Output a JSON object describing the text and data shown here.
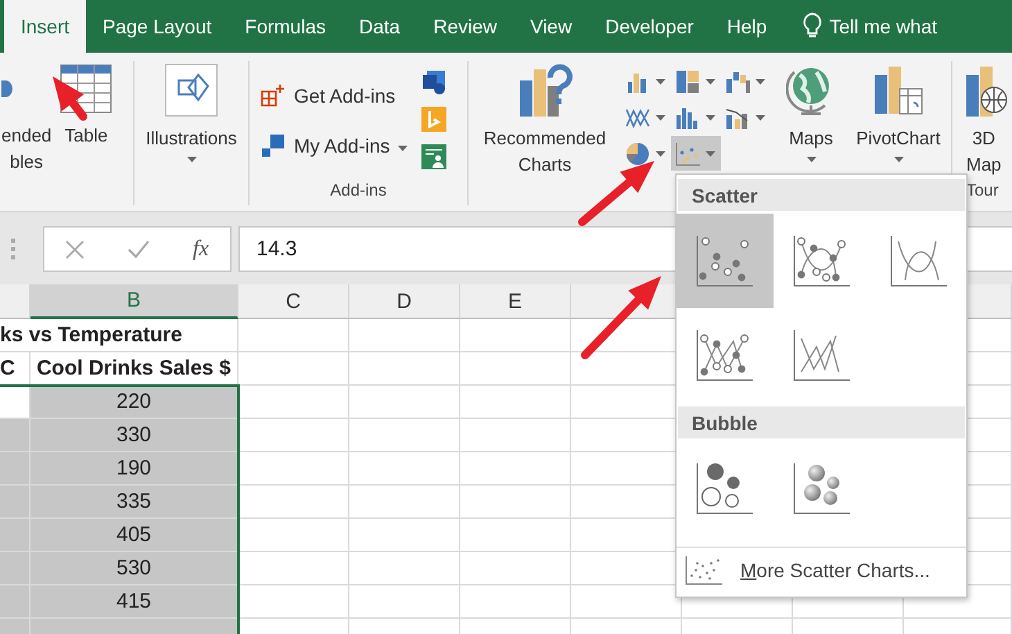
{
  "tabs": [
    {
      "label": "Insert",
      "selected": true
    },
    {
      "label": "Page Layout",
      "selected": false
    },
    {
      "label": "Formulas",
      "selected": false
    },
    {
      "label": "Data",
      "selected": false
    },
    {
      "label": "Review",
      "selected": false
    },
    {
      "label": "View",
      "selected": false
    },
    {
      "label": "Developer",
      "selected": false
    },
    {
      "label": "Help",
      "selected": false
    }
  ],
  "tell_me": "Tell me what",
  "ribbon": {
    "tables": {
      "recommended_lines": [
        "ended",
        "bles"
      ],
      "table_label": "Table"
    },
    "illustrations": {
      "label": "Illustrations"
    },
    "addins": {
      "get_label": "Get Add-ins",
      "my_label": "My Add-ins",
      "group_label": "Add-ins"
    },
    "charts": {
      "recommended_lines": [
        "Recommended",
        "Charts"
      ],
      "chart_buttons": [
        {
          "kind": "column",
          "selected": false
        },
        {
          "kind": "hierarchy",
          "selected": false
        },
        {
          "kind": "waterfall",
          "selected": false
        },
        {
          "kind": "line",
          "selected": false
        },
        {
          "kind": "statistic",
          "selected": false
        },
        {
          "kind": "combo",
          "selected": false
        },
        {
          "kind": "pie",
          "selected": false
        },
        {
          "kind": "scatter",
          "selected": true
        }
      ],
      "maps_label": "Maps",
      "pivotchart_label": "PivotChart"
    },
    "tours": {
      "label_lines": [
        "3D",
        "Map"
      ],
      "group_label": "Tour"
    }
  },
  "formula_bar": {
    "fx": "fx",
    "value": "14.3"
  },
  "columns": [
    {
      "selected": false
    },
    {
      "label": "B",
      "selected": true
    },
    {
      "label": "C",
      "selected": false
    },
    {
      "label": "D",
      "selected": false
    },
    {
      "label": "E",
      "selected": false
    },
    {
      "selected": false
    }
  ],
  "rows": [
    {
      "kind": "title",
      "text": "ks vs Temperature"
    },
    {
      "kind": "data",
      "cells": [
        {
          "text": "C",
          "selected": false
        },
        {
          "text": "Cool Drinks Sales $",
          "selected": false
        }
      ]
    },
    {
      "kind": "data",
      "cells": [
        {
          "selected": false
        },
        {
          "text": "220",
          "selected": true
        }
      ]
    },
    {
      "kind": "data",
      "cells": [
        {
          "selected": true
        },
        {
          "text": "330",
          "selected": true
        }
      ]
    },
    {
      "kind": "data",
      "cells": [
        {
          "selected": true
        },
        {
          "text": "190",
          "selected": true
        }
      ]
    },
    {
      "kind": "data",
      "cells": [
        {
          "selected": true
        },
        {
          "text": "335",
          "selected": true
        }
      ]
    },
    {
      "kind": "data",
      "cells": [
        {
          "selected": true
        },
        {
          "text": "405",
          "selected": true
        }
      ]
    },
    {
      "kind": "data",
      "cells": [
        {
          "selected": true
        },
        {
          "text": "530",
          "selected": true
        }
      ]
    },
    {
      "kind": "data",
      "cells": [
        {
          "selected": true
        },
        {
          "text": "415",
          "selected": true
        }
      ]
    },
    {
      "kind": "data",
      "cells": [
        {
          "selected": true
        },
        {
          "selected": true
        }
      ]
    }
  ],
  "dropdown": {
    "sections": [
      {
        "title": "Scatter",
        "items": [
          {
            "kind": "markers",
            "selected": true
          },
          {
            "kind": "smooth-markers",
            "selected": false
          },
          {
            "kind": "smooth",
            "selected": false
          },
          {
            "kind": "straight-markers",
            "selected": false
          },
          {
            "kind": "straight",
            "selected": false
          }
        ]
      },
      {
        "title": "Bubble",
        "items": [
          {
            "kind": "bubble",
            "selected": false
          },
          {
            "kind": "bubble-3d",
            "selected": false
          }
        ]
      }
    ],
    "more_label": "More Scatter Charts..."
  }
}
